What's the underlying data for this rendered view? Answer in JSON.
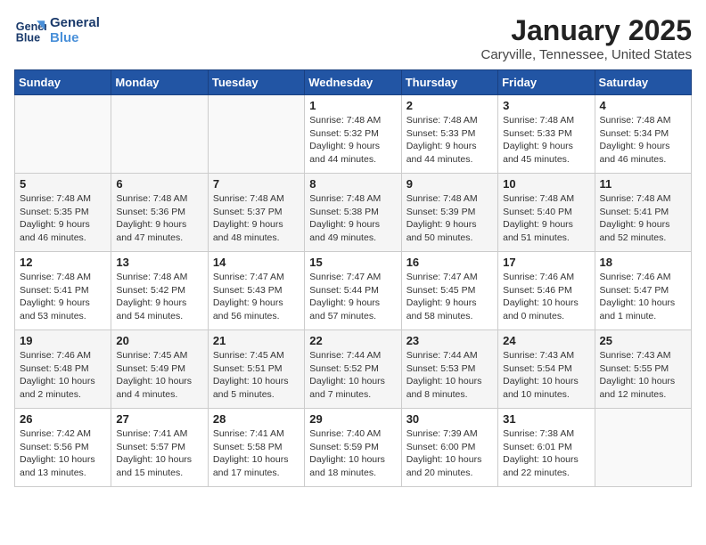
{
  "header": {
    "logo_line1": "General",
    "logo_line2": "Blue",
    "month": "January 2025",
    "location": "Caryville, Tennessee, United States"
  },
  "weekdays": [
    "Sunday",
    "Monday",
    "Tuesday",
    "Wednesday",
    "Thursday",
    "Friday",
    "Saturday"
  ],
  "weeks": [
    [
      {
        "day": "",
        "content": ""
      },
      {
        "day": "",
        "content": ""
      },
      {
        "day": "",
        "content": ""
      },
      {
        "day": "1",
        "content": "Sunrise: 7:48 AM\nSunset: 5:32 PM\nDaylight: 9 hours\nand 44 minutes."
      },
      {
        "day": "2",
        "content": "Sunrise: 7:48 AM\nSunset: 5:33 PM\nDaylight: 9 hours\nand 44 minutes."
      },
      {
        "day": "3",
        "content": "Sunrise: 7:48 AM\nSunset: 5:33 PM\nDaylight: 9 hours\nand 45 minutes."
      },
      {
        "day": "4",
        "content": "Sunrise: 7:48 AM\nSunset: 5:34 PM\nDaylight: 9 hours\nand 46 minutes."
      }
    ],
    [
      {
        "day": "5",
        "content": "Sunrise: 7:48 AM\nSunset: 5:35 PM\nDaylight: 9 hours\nand 46 minutes."
      },
      {
        "day": "6",
        "content": "Sunrise: 7:48 AM\nSunset: 5:36 PM\nDaylight: 9 hours\nand 47 minutes."
      },
      {
        "day": "7",
        "content": "Sunrise: 7:48 AM\nSunset: 5:37 PM\nDaylight: 9 hours\nand 48 minutes."
      },
      {
        "day": "8",
        "content": "Sunrise: 7:48 AM\nSunset: 5:38 PM\nDaylight: 9 hours\nand 49 minutes."
      },
      {
        "day": "9",
        "content": "Sunrise: 7:48 AM\nSunset: 5:39 PM\nDaylight: 9 hours\nand 50 minutes."
      },
      {
        "day": "10",
        "content": "Sunrise: 7:48 AM\nSunset: 5:40 PM\nDaylight: 9 hours\nand 51 minutes."
      },
      {
        "day": "11",
        "content": "Sunrise: 7:48 AM\nSunset: 5:41 PM\nDaylight: 9 hours\nand 52 minutes."
      }
    ],
    [
      {
        "day": "12",
        "content": "Sunrise: 7:48 AM\nSunset: 5:41 PM\nDaylight: 9 hours\nand 53 minutes."
      },
      {
        "day": "13",
        "content": "Sunrise: 7:48 AM\nSunset: 5:42 PM\nDaylight: 9 hours\nand 54 minutes."
      },
      {
        "day": "14",
        "content": "Sunrise: 7:47 AM\nSunset: 5:43 PM\nDaylight: 9 hours\nand 56 minutes."
      },
      {
        "day": "15",
        "content": "Sunrise: 7:47 AM\nSunset: 5:44 PM\nDaylight: 9 hours\nand 57 minutes."
      },
      {
        "day": "16",
        "content": "Sunrise: 7:47 AM\nSunset: 5:45 PM\nDaylight: 9 hours\nand 58 minutes."
      },
      {
        "day": "17",
        "content": "Sunrise: 7:46 AM\nSunset: 5:46 PM\nDaylight: 10 hours\nand 0 minutes."
      },
      {
        "day": "18",
        "content": "Sunrise: 7:46 AM\nSunset: 5:47 PM\nDaylight: 10 hours\nand 1 minute."
      }
    ],
    [
      {
        "day": "19",
        "content": "Sunrise: 7:46 AM\nSunset: 5:48 PM\nDaylight: 10 hours\nand 2 minutes."
      },
      {
        "day": "20",
        "content": "Sunrise: 7:45 AM\nSunset: 5:49 PM\nDaylight: 10 hours\nand 4 minutes."
      },
      {
        "day": "21",
        "content": "Sunrise: 7:45 AM\nSunset: 5:51 PM\nDaylight: 10 hours\nand 5 minutes."
      },
      {
        "day": "22",
        "content": "Sunrise: 7:44 AM\nSunset: 5:52 PM\nDaylight: 10 hours\nand 7 minutes."
      },
      {
        "day": "23",
        "content": "Sunrise: 7:44 AM\nSunset: 5:53 PM\nDaylight: 10 hours\nand 8 minutes."
      },
      {
        "day": "24",
        "content": "Sunrise: 7:43 AM\nSunset: 5:54 PM\nDaylight: 10 hours\nand 10 minutes."
      },
      {
        "day": "25",
        "content": "Sunrise: 7:43 AM\nSunset: 5:55 PM\nDaylight: 10 hours\nand 12 minutes."
      }
    ],
    [
      {
        "day": "26",
        "content": "Sunrise: 7:42 AM\nSunset: 5:56 PM\nDaylight: 10 hours\nand 13 minutes."
      },
      {
        "day": "27",
        "content": "Sunrise: 7:41 AM\nSunset: 5:57 PM\nDaylight: 10 hours\nand 15 minutes."
      },
      {
        "day": "28",
        "content": "Sunrise: 7:41 AM\nSunset: 5:58 PM\nDaylight: 10 hours\nand 17 minutes."
      },
      {
        "day": "29",
        "content": "Sunrise: 7:40 AM\nSunset: 5:59 PM\nDaylight: 10 hours\nand 18 minutes."
      },
      {
        "day": "30",
        "content": "Sunrise: 7:39 AM\nSunset: 6:00 PM\nDaylight: 10 hours\nand 20 minutes."
      },
      {
        "day": "31",
        "content": "Sunrise: 7:38 AM\nSunset: 6:01 PM\nDaylight: 10 hours\nand 22 minutes."
      },
      {
        "day": "",
        "content": ""
      }
    ]
  ]
}
